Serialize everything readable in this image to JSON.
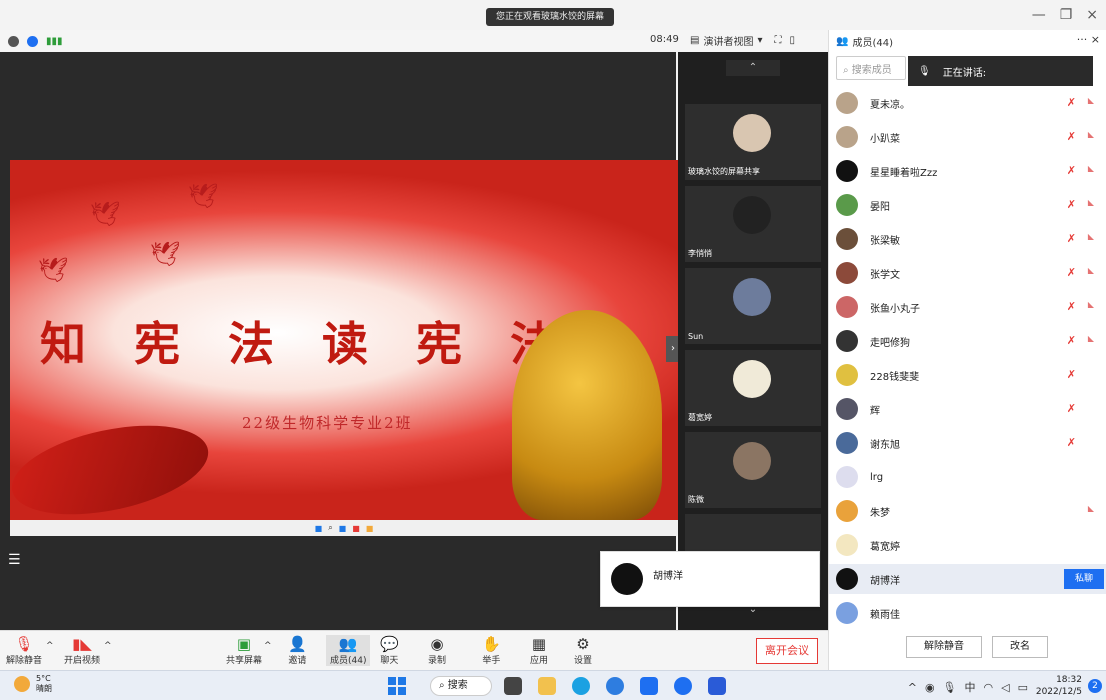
{
  "banner": "您正在观看玻璃水饺的屏幕",
  "toolbar": {
    "time": "08:49",
    "view_label": "演讲者视图"
  },
  "slide": {
    "title": "知宪法读宪法",
    "subtitle": "22级生物科学专业2班"
  },
  "video_tiles": [
    {
      "name": "玻璃水饺的屏幕共享"
    },
    {
      "name": "李悄悄"
    },
    {
      "name": "Sun"
    },
    {
      "name": "葛宽婷"
    },
    {
      "name": "陈微"
    }
  ],
  "active_speaker": "胡博洋",
  "controls": {
    "mute": "解除静音",
    "video": "开启视频",
    "share": "共享屏幕",
    "invite": "邀请",
    "members": "成员(44)",
    "chat": "聊天",
    "record": "录制",
    "raise": "举手",
    "apps": "应用",
    "settings": "设置",
    "leave": "离开会议"
  },
  "panel": {
    "title": "成员(44)",
    "search_placeholder": "搜索成员",
    "speaking_label": "正在讲话:",
    "members": [
      {
        "name": "夏未凉。"
      },
      {
        "name": "小趴菜"
      },
      {
        "name": "星星睡着啦Zzz"
      },
      {
        "name": "晏阳"
      },
      {
        "name": "张梁敏"
      },
      {
        "name": "张学文"
      },
      {
        "name": "张鱼小丸子"
      },
      {
        "name": "走吧修狗"
      },
      {
        "name": "228钱斐斐"
      },
      {
        "name": "辉"
      },
      {
        "name": "谢东旭"
      },
      {
        "name": "lrg"
      },
      {
        "name": "朱梦"
      },
      {
        "name": "葛宽婷"
      },
      {
        "name": "胡博洋"
      },
      {
        "name": "赖雨佳"
      }
    ],
    "private_chat": "私聊",
    "unmute_all": "解除静音",
    "rename": "改名"
  },
  "taskbar": {
    "temp": "5°C",
    "weather": "晴朗",
    "search": "搜索",
    "ime": "中",
    "time": "18:32",
    "date": "2022/12/5"
  },
  "colors": {
    "leave_red": "#e53935",
    "accent_blue": "#1e6ff1"
  }
}
